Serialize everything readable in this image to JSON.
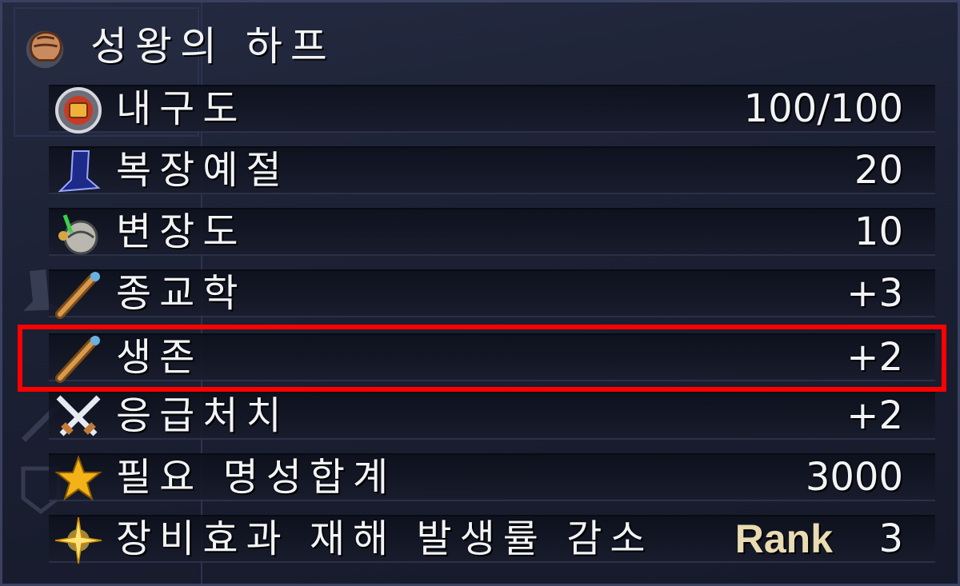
{
  "item": {
    "name": "성왕의 하프",
    "icon": "harp-fist-icon",
    "stats": [
      {
        "icon": "durability-shield-icon",
        "label": "내구도",
        "value": "100/100"
      },
      {
        "icon": "blue-hat-icon",
        "label": "복장예절",
        "value": "20"
      },
      {
        "icon": "disguise-mask-icon",
        "label": "변장도",
        "value": "10"
      },
      {
        "icon": "telescope-icon",
        "label": "종교학",
        "value": "+3"
      },
      {
        "icon": "telescope-icon",
        "label": "생존",
        "value": "+2"
      },
      {
        "icon": "crossed-swords-icon",
        "label": "응급처치",
        "value": "+2"
      },
      {
        "icon": "star-icon",
        "label": "필요 명성합계",
        "value": "3000"
      },
      {
        "icon": "sparkle-icon",
        "label": "장비효과 재해 발생률 감소",
        "rank_label": "Rank",
        "value": "3"
      }
    ]
  },
  "highlight": {
    "target": "생존",
    "color": "#ff0000"
  }
}
